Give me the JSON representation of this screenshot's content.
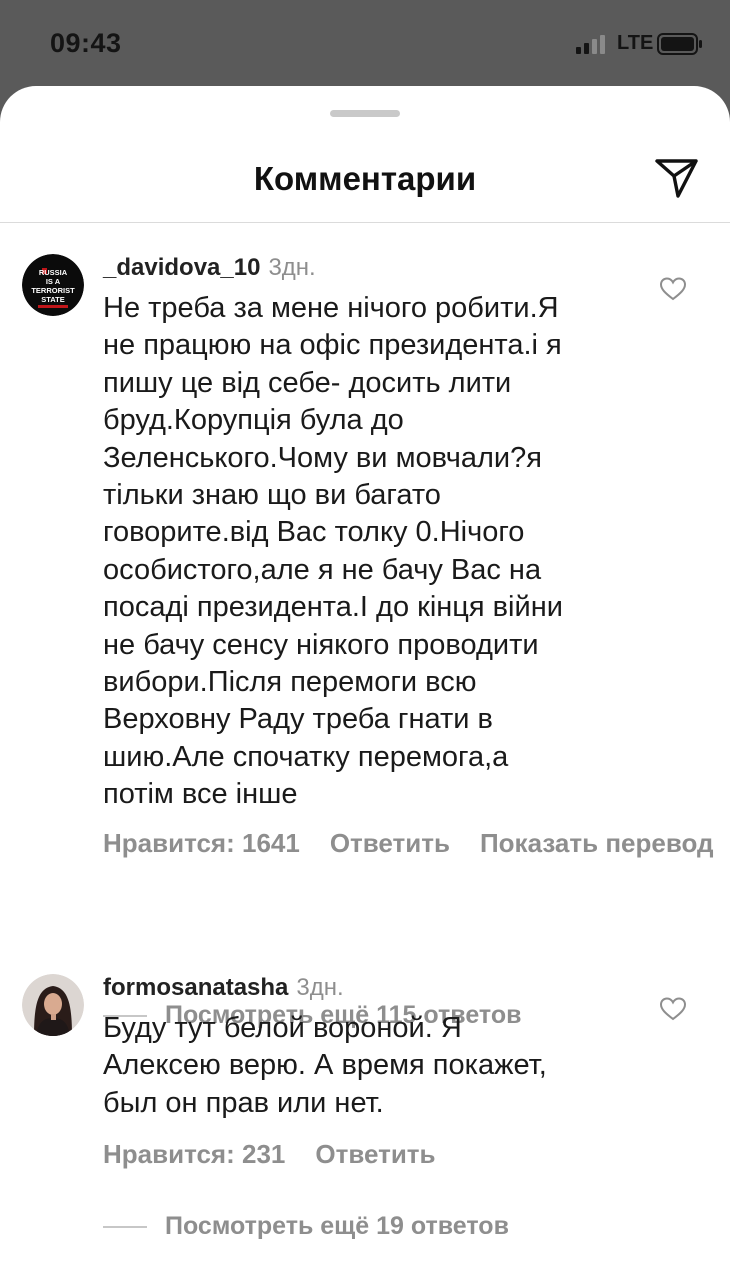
{
  "status_bar": {
    "time": "09:43",
    "network": "LTE"
  },
  "sheet": {
    "title": "Комментарии",
    "share_icon": "paper-plane-icon"
  },
  "avatar_badge": {
    "line1": "RUSSIA",
    "line2": "IS A",
    "line3": "TERRORIST",
    "line4": "STATE"
  },
  "comments": [
    {
      "username": "_davidova_10",
      "time": "3дн.",
      "text_lines": [
        "Не треба за мене нічого робити.Я",
        "не працюю на офіс президента.і я",
        "пишу це від себе- досить лити",
        "бруд.Корупція була до",
        "Зеленського.Чому ви мовчали?я",
        "тільки знаю що ви багато",
        "говорите.від Вас толку 0.Нічого",
        "особистого,але я не бачу Вас на",
        "посаді президента.І до кінця війни",
        "не бачу сенсу ніякого проводити",
        "вибори.Після перемоги всю",
        "Верховну Раду треба гнати в",
        "шию.Але спочатку перемога,а",
        "потім все інше"
      ],
      "likes_label": "Нравится: 1641",
      "reply_label": "Ответить",
      "translate_label": "Показать перевод",
      "view_replies": "Посмотреть ещё 115 ответов"
    },
    {
      "username": "formosanatasha",
      "time": "3дн.",
      "text_lines": [
        "Буду тут белой вороной. Я",
        "Алексею верю. А время покажет,",
        "был он прав или нет."
      ],
      "likes_label": "Нравится: 231",
      "reply_label": "Ответить",
      "view_replies": "Посмотреть ещё 19 ответов"
    }
  ]
}
